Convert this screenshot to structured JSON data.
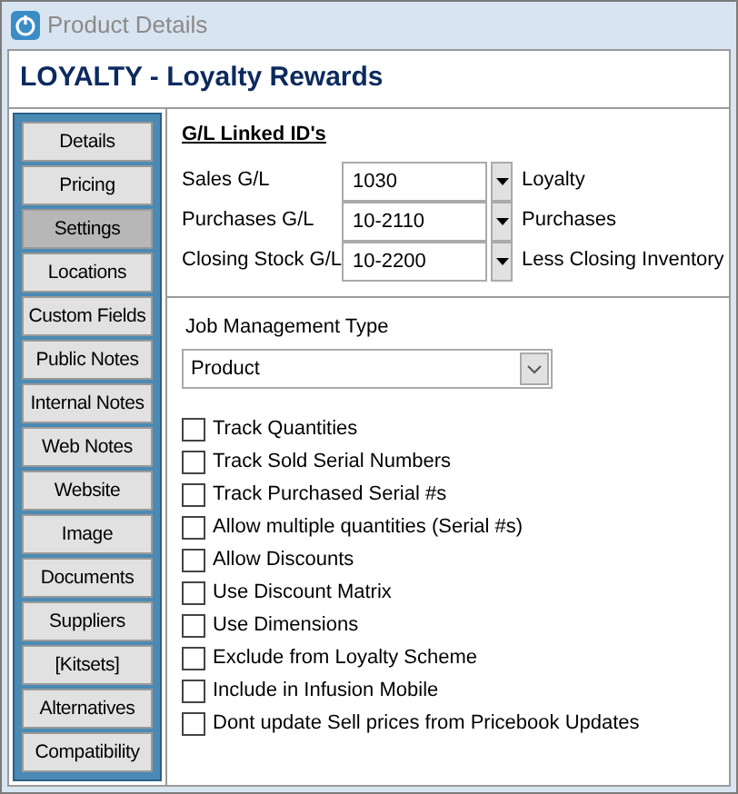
{
  "window": {
    "title": "Product Details"
  },
  "header": {
    "title": "LOYALTY - Loyalty Rewards"
  },
  "sidebar": {
    "items": [
      {
        "label": "Details",
        "selected": false
      },
      {
        "label": "Pricing",
        "selected": false
      },
      {
        "label": "Settings",
        "selected": true
      },
      {
        "label": "Locations",
        "selected": false
      },
      {
        "label": "Custom Fields",
        "selected": false
      },
      {
        "label": "Public Notes",
        "selected": false
      },
      {
        "label": "Internal Notes",
        "selected": false
      },
      {
        "label": "Web Notes",
        "selected": false
      },
      {
        "label": "Website",
        "selected": false
      },
      {
        "label": "Image",
        "selected": false
      },
      {
        "label": "Documents",
        "selected": false
      },
      {
        "label": "Suppliers",
        "selected": false
      },
      {
        "label": "[Kitsets]",
        "selected": false
      },
      {
        "label": "Alternatives",
        "selected": false
      },
      {
        "label": "Compatibility",
        "selected": false
      }
    ]
  },
  "gl_section": {
    "heading": "G/L Linked ID's",
    "rows": [
      {
        "label": "Sales G/L",
        "value": "1030",
        "description": "Loyalty"
      },
      {
        "label": "Purchases G/L",
        "value": "10-2110",
        "description": "Purchases"
      },
      {
        "label": "Closing Stock G/L",
        "value": "10-2200",
        "description": "Less Closing Inventory"
      }
    ]
  },
  "job_management": {
    "label": "Job Management Type",
    "value": "Product"
  },
  "options": [
    {
      "label": "Track Quantities",
      "checked": false
    },
    {
      "label": "Track Sold Serial Numbers",
      "checked": false
    },
    {
      "label": "Track Purchased Serial #s",
      "checked": false
    },
    {
      "label": "Allow multiple quantities (Serial #s)",
      "checked": false
    },
    {
      "label": "Allow Discounts",
      "checked": false
    },
    {
      "label": "Use Discount Matrix",
      "checked": false
    },
    {
      "label": "Use Dimensions",
      "checked": false
    },
    {
      "label": "Exclude from Loyalty Scheme",
      "checked": false
    },
    {
      "label": "Include in Infusion Mobile",
      "checked": false
    },
    {
      "label": "Dont update Sell prices from Pricebook Updates",
      "checked": false
    }
  ]
}
